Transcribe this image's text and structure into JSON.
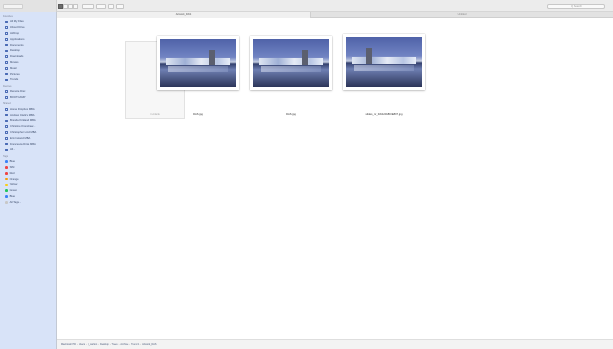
{
  "window": {
    "tab_active": "Artwork_DAS",
    "tab_inactive": "Untitled",
    "search_placeholder": "Q Search"
  },
  "sidebar": {
    "sections": [
      {
        "title": "Favorites",
        "items": [
          {
            "label": "All My Files",
            "icon": "all-files-icon"
          },
          {
            "label": "iCloud Drive",
            "icon": "cloud-icon"
          },
          {
            "label": "AirDrop",
            "icon": "airdrop-icon"
          },
          {
            "label": "Applications",
            "icon": "applications-icon"
          },
          {
            "label": "Documents",
            "icon": "documents-icon"
          },
          {
            "label": "Desktop",
            "icon": "desktop-icon"
          },
          {
            "label": "Downloads",
            "icon": "downloads-icon"
          },
          {
            "label": "Movies",
            "icon": "movies-icon"
          },
          {
            "label": "Music",
            "icon": "music-icon"
          },
          {
            "label": "Pictures",
            "icon": "pictures-icon"
          },
          {
            "label": "Trends",
            "icon": "folder-icon"
          }
        ]
      },
      {
        "title": "Devices",
        "items": [
          {
            "label": "Remote Disc",
            "icon": "disc-icon"
          },
          {
            "label": "BOOTCAMP",
            "icon": "disk-icon"
          }
        ]
      },
      {
        "title": "Shared",
        "items": [
          {
            "label": "Home Dropbox MBA",
            "icon": "display-icon"
          },
          {
            "label": "Andrew Clark's MBA",
            "icon": "display-icon"
          },
          {
            "label": "Brenda Kirkland MBA",
            "icon": "display-icon"
          },
          {
            "label": "Christine Kronshaw...",
            "icon": "display-icon"
          },
          {
            "label": "Christopher Lind MBA",
            "icon": "display-icon"
          },
          {
            "label": "Erin Ireland MBA",
            "icon": "display-icon"
          },
          {
            "label": "Francesca Dinis MBA",
            "icon": "display-icon"
          },
          {
            "label": "All...",
            "icon": "globe-icon"
          }
        ]
      },
      {
        "title": "Tags",
        "items": [
          {
            "label": "Blue",
            "color": "#3b82f6"
          },
          {
            "label": "SIM",
            "color": "#ef4444"
          },
          {
            "label": "Red",
            "color": "#ef4444"
          },
          {
            "label": "Orange",
            "color": "#f59e0b"
          },
          {
            "label": "Yellow",
            "color": "#facc15"
          },
          {
            "label": "Green",
            "color": "#22c55e"
          },
          {
            "label": "Blue",
            "color": "#3b82f6"
          },
          {
            "label": "All Tags...",
            "color": "#c8c8c8"
          }
        ]
      }
    ]
  },
  "files": [
    {
      "name": "rn-blank",
      "kind": "document"
    },
    {
      "name": "DAS.jpg",
      "kind": "image"
    },
    {
      "name": "DAS.jpg",
      "kind": "image"
    },
    {
      "name": "slides_nr_DAS2018KIE807.jpg",
      "kind": "image"
    }
  ],
  "pathbar": [
    "Macintosh HD",
    "Users",
    "r_carlton",
    "Desktop",
    "Trees",
    "Archive",
    "Trend 1",
    "Artwork_DAS"
  ]
}
